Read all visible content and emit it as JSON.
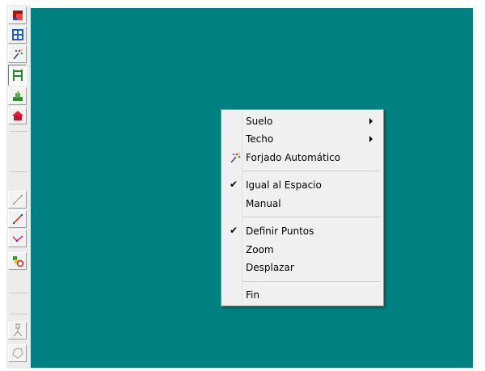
{
  "toolbar": {
    "tools": [
      {
        "icon": "red-room-icon"
      },
      {
        "icon": "blue-grid-window-icon"
      },
      {
        "icon": "sparkle-wand-icon"
      },
      {
        "icon": "green-ladder-icon"
      },
      {
        "icon": "green-figure-icon"
      },
      {
        "icon": "red-house-icon"
      },
      {
        "icon": "gray-line-icon"
      },
      {
        "icon": "red-line-icon"
      },
      {
        "icon": "polyline-icon"
      },
      {
        "icon": "green-red-shapes-icon"
      },
      {
        "icon": "stick-figure-icon"
      },
      {
        "icon": "lasso-polygon-icon"
      }
    ],
    "pressed_tool": "green-ladder-icon"
  },
  "canvas": {
    "background": "#008080"
  },
  "context_menu": {
    "items": [
      {
        "label": "Suelo",
        "submenu": true
      },
      {
        "label": "Techo",
        "submenu": true
      },
      {
        "label": "Forjado Automático",
        "icon": "sparkle-wand-icon"
      },
      {
        "label": "Igual al Espacio",
        "checked": true
      },
      {
        "label": "Manual"
      },
      {
        "label": "Definir Puntos",
        "checked": true
      },
      {
        "label": "Zoom"
      },
      {
        "label": "Desplazar"
      },
      {
        "label": "Fin"
      }
    ],
    "check_glyph": "✔"
  }
}
